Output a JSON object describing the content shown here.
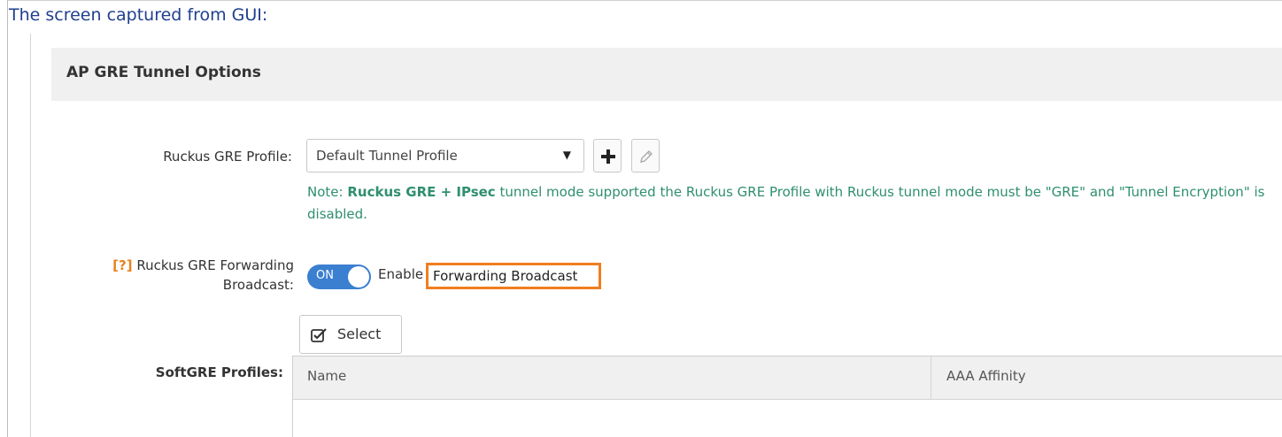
{
  "caption": "The screen captured from GUI:",
  "section": {
    "title": "AP GRE Tunnel Options"
  },
  "gre_profile": {
    "label": "Ruckus GRE Profile:",
    "value": "Default Tunnel Profile",
    "caret": "▼",
    "add_icon": "plus-icon",
    "edit_icon": "pencil-icon"
  },
  "note": {
    "prefix": "Note: ",
    "bold": "Ruckus GRE + IPsec",
    "text": " tunnel mode supported the Ruckus GRE Profile with Ruckus tunnel mode must be \"GRE\" and \"Tunnel Encryption\" is disabled."
  },
  "forwarding": {
    "help": "[?]",
    "label_line1": "Ruckus GRE Forwarding",
    "label_line2": "Broadcast:",
    "toggle_text": "ON",
    "enable_text": "Enable",
    "highlight_text": "Forwarding Broadcast"
  },
  "softgre": {
    "label": "SoftGRE Profiles:",
    "select_button": "Select",
    "select_icon": "checkbox-edit-icon",
    "columns": [
      "Name",
      "AAA Affinity"
    ]
  },
  "colors": {
    "accent": "#3a7fd0",
    "note_green": "#2f8f6f",
    "highlight_orange": "#f27d1e",
    "help_orange": "#e8821e"
  }
}
